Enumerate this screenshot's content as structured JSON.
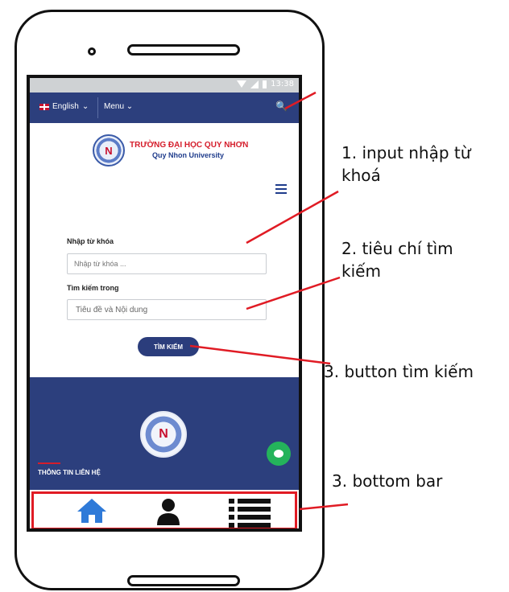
{
  "status_bar": {
    "time": "13:38"
  },
  "top_bar": {
    "language": "English",
    "menu": "Menu"
  },
  "university": {
    "vn_name": "TRƯỜNG ĐẠI HỌC QUY NHƠN",
    "en_name": "Quy Nhon University"
  },
  "search_form": {
    "keyword_label": "Nhập từ khóa",
    "keyword_placeholder": "Nhập từ khóa ...",
    "scope_label": "Tìm kiếm trong",
    "scope_value": "Tiêu đề và Nội dung",
    "submit_label": "TÌM KIẾM"
  },
  "footer": {
    "contact_title": "THÔNG TIN LIÊN HỆ"
  },
  "annotations": {
    "a1": "1. input nhập từ khoá",
    "a2": "2. tiêu chí tìm kiếm",
    "a3": "3. button tìm kiếm",
    "a4": "3. bottom bar"
  },
  "colors": {
    "navy": "#2c3f7d",
    "annotation_red": "#e01b24",
    "chat_green": "#24b35b",
    "icon_blue": "#2f7ad8"
  },
  "icons": {
    "home": "home-icon",
    "user": "user-icon",
    "list": "list-icon",
    "search": "search-icon",
    "chat": "chat-icon",
    "menu": "hamburger-icon"
  }
}
